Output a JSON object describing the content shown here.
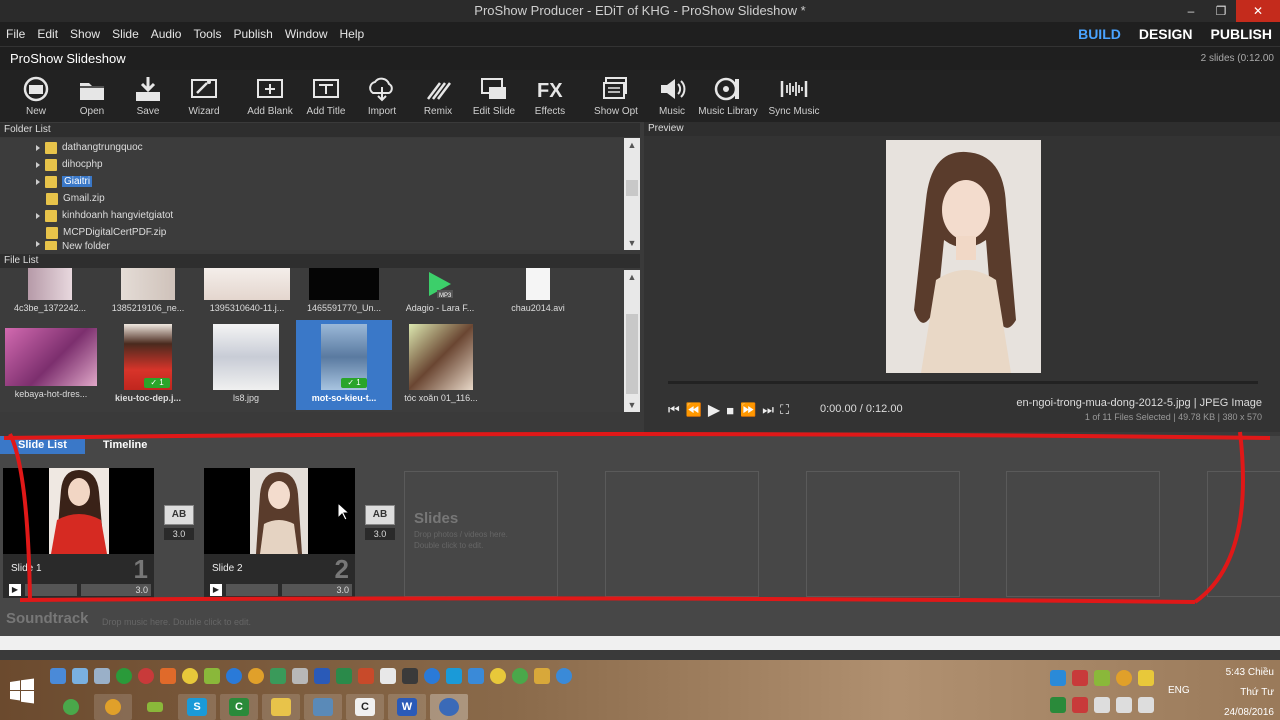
{
  "window": {
    "title": "ProShow Producer - EDiT of KHG - ProShow Slideshow *",
    "minimize": "‒",
    "maximize": "❐",
    "close": "✕"
  },
  "menu": [
    "File",
    "Edit",
    "Show",
    "Slide",
    "Audio",
    "Tools",
    "Publish",
    "Window",
    "Help"
  ],
  "modes": [
    "BUILD",
    "DESIGN",
    "PUBLISH"
  ],
  "project": {
    "title": "ProShow Slideshow",
    "info": "2 slides (0:12.00"
  },
  "toolbar": [
    {
      "label": "New",
      "icon": "new-show-icon"
    },
    {
      "label": "Open",
      "icon": "folder-open-icon"
    },
    {
      "label": "Save",
      "icon": "save-icon"
    },
    {
      "label": "Wizard",
      "icon": "wizard-icon"
    },
    {
      "label": "Add Blank",
      "icon": "add-blank-icon"
    },
    {
      "label": "Add Title",
      "icon": "add-title-icon"
    },
    {
      "label": "Import",
      "icon": "import-icon"
    },
    {
      "label": "Remix",
      "icon": "remix-icon"
    },
    {
      "label": "Edit Slide",
      "icon": "edit-slide-icon"
    },
    {
      "label": "Effects",
      "icon": "fx-icon"
    },
    {
      "label": "Show Opt",
      "icon": "show-options-icon"
    },
    {
      "label": "Music",
      "icon": "speaker-icon"
    },
    {
      "label": "Music Library",
      "icon": "music-library-icon"
    },
    {
      "label": "Sync Music",
      "icon": "sync-music-icon"
    }
  ],
  "folder_list": {
    "header": "Folder List",
    "items": [
      {
        "name": "dathangtrungquoc",
        "expandable": true,
        "selected": false
      },
      {
        "name": "dihocphp",
        "expandable": true,
        "selected": false
      },
      {
        "name": "Giaitri",
        "expandable": true,
        "selected": true
      },
      {
        "name": "Gmail.zip",
        "expandable": false,
        "selected": false
      },
      {
        "name": "kinhdoanh hangvietgiatot",
        "expandable": true,
        "selected": false
      },
      {
        "name": "MCPDigitalCertPDF.zip",
        "expandable": false,
        "selected": false
      },
      {
        "name": "New folder",
        "expandable": true,
        "selected": false
      }
    ]
  },
  "file_list": {
    "header": "File List",
    "row1": [
      "4c3be_1372242...",
      "1385219106_ne...",
      "1395310640-11.j...",
      "1465591770_Un...",
      "Adagio - Lara F...",
      "chau2014.avi"
    ],
    "row2": [
      {
        "name": "kebaya-hot-dres...",
        "used": false,
        "bold": false
      },
      {
        "name": "kieu-toc-dep.j...",
        "used": true,
        "bold": true
      },
      {
        "name": "ls8.jpg",
        "used": false,
        "bold": false
      },
      {
        "name": "mot-so-kieu-t...",
        "used": true,
        "bold": true
      },
      {
        "name": "tóc xoăn 01_116...",
        "used": false,
        "bold": false
      }
    ],
    "used_mark": "✓ 1"
  },
  "preview": {
    "header": "Preview",
    "timecode": "0:00.00 / 0:12.00",
    "file": "en-ngoi-trong-mua-dong-2012-5.jpg  |  JPEG Image",
    "info": "1 of 11 Files Selected  |  49.78 KB  |  380 x 570",
    "controls": [
      "⏮",
      "⏪",
      "▶",
      "■",
      "⏩",
      "⏭",
      "⛶"
    ]
  },
  "slide_tabs": [
    "Slide List",
    "Timeline"
  ],
  "slides": [
    {
      "name": "Slide 1",
      "number": "1",
      "duration": "3.0"
    },
    {
      "name": "Slide 2",
      "number": "2",
      "duration": "3.0"
    }
  ],
  "transitions": [
    {
      "label": "AB",
      "duration": "3.0"
    },
    {
      "label": "AB",
      "duration": "3.0"
    }
  ],
  "slides_placeholder": {
    "title": "Slides",
    "line1": "Drop photos / videos here.",
    "line2": "Double click to edit."
  },
  "soundtrack": {
    "title": "Soundtrack",
    "hint": "Drop music here.  Double click to edit."
  },
  "taskbar": {
    "lang": "ENG",
    "time": "5:43 Chiều",
    "day": "Thứ Tư",
    "date": "24/08/2016"
  },
  "colors": {
    "accent": "#3a78c8",
    "mode_active": "#4aa3ff",
    "annotation": "#e01818"
  }
}
